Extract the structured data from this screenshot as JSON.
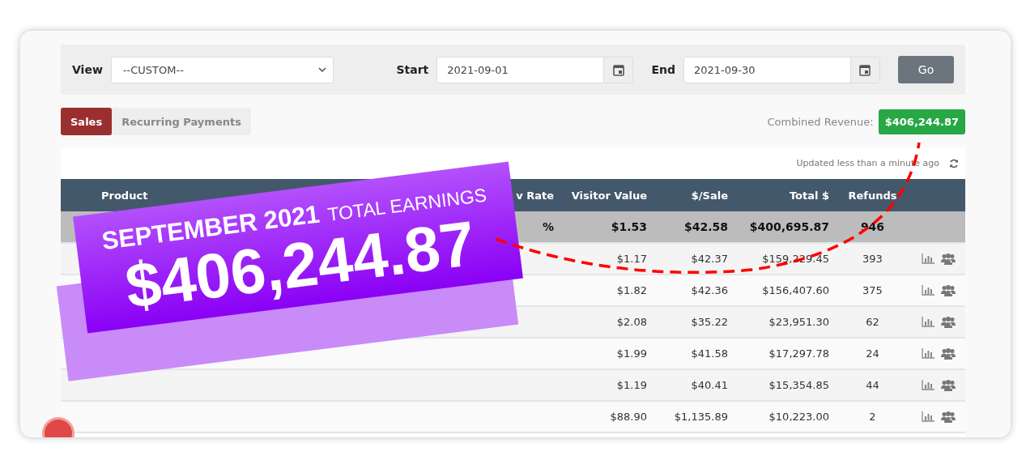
{
  "filters": {
    "view": {
      "label": "View",
      "value": "--CUSTOM--"
    },
    "start": {
      "label": "Start",
      "value": "2021-09-01"
    },
    "end": {
      "label": "End",
      "value": "2021-09-30"
    },
    "go_button": "Go"
  },
  "tabs": [
    {
      "label": "Sales",
      "selected": true
    },
    {
      "label": "Recurring Payments",
      "selected": false
    }
  ],
  "combined_revenue": {
    "label": "Combined Revenue:",
    "value": "$406,244.87"
  },
  "updated": "Updated less than a minute ago",
  "table": {
    "columns": [
      "Product",
      "v Rate",
      "Visitor Value",
      "$/Sale",
      "Total $",
      "Refunds"
    ],
    "total_row": {
      "rate": "%",
      "visitor_value": "$1.53",
      "per_sale": "$42.58",
      "total": "$400,695.87",
      "refunds": "946"
    },
    "rows": [
      {
        "visitor_value": "$1.17",
        "per_sale": "$42.37",
        "total": "$159,229.45",
        "refunds": "393"
      },
      {
        "visitor_value": "$1.82",
        "per_sale": "$42.36",
        "total": "$156,407.60",
        "refunds": "375"
      },
      {
        "visitor_value": "$2.08",
        "per_sale": "$35.22",
        "total": "$23,951.30",
        "refunds": "62"
      },
      {
        "visitor_value": "$1.99",
        "per_sale": "$41.58",
        "total": "$17,297.78",
        "refunds": "24"
      },
      {
        "visitor_value": "$1.19",
        "per_sale": "$40.41",
        "total": "$15,354.85",
        "refunds": "44"
      },
      {
        "visitor_value": "$88.90",
        "per_sale": "$1,135.89",
        "total": "$10,223.00",
        "refunds": "2"
      }
    ]
  },
  "banner": {
    "headline_bold": "SEPTEMBER 2021",
    "headline_light": "TOTAL EARNINGS",
    "amount": "$406,244.87"
  }
}
